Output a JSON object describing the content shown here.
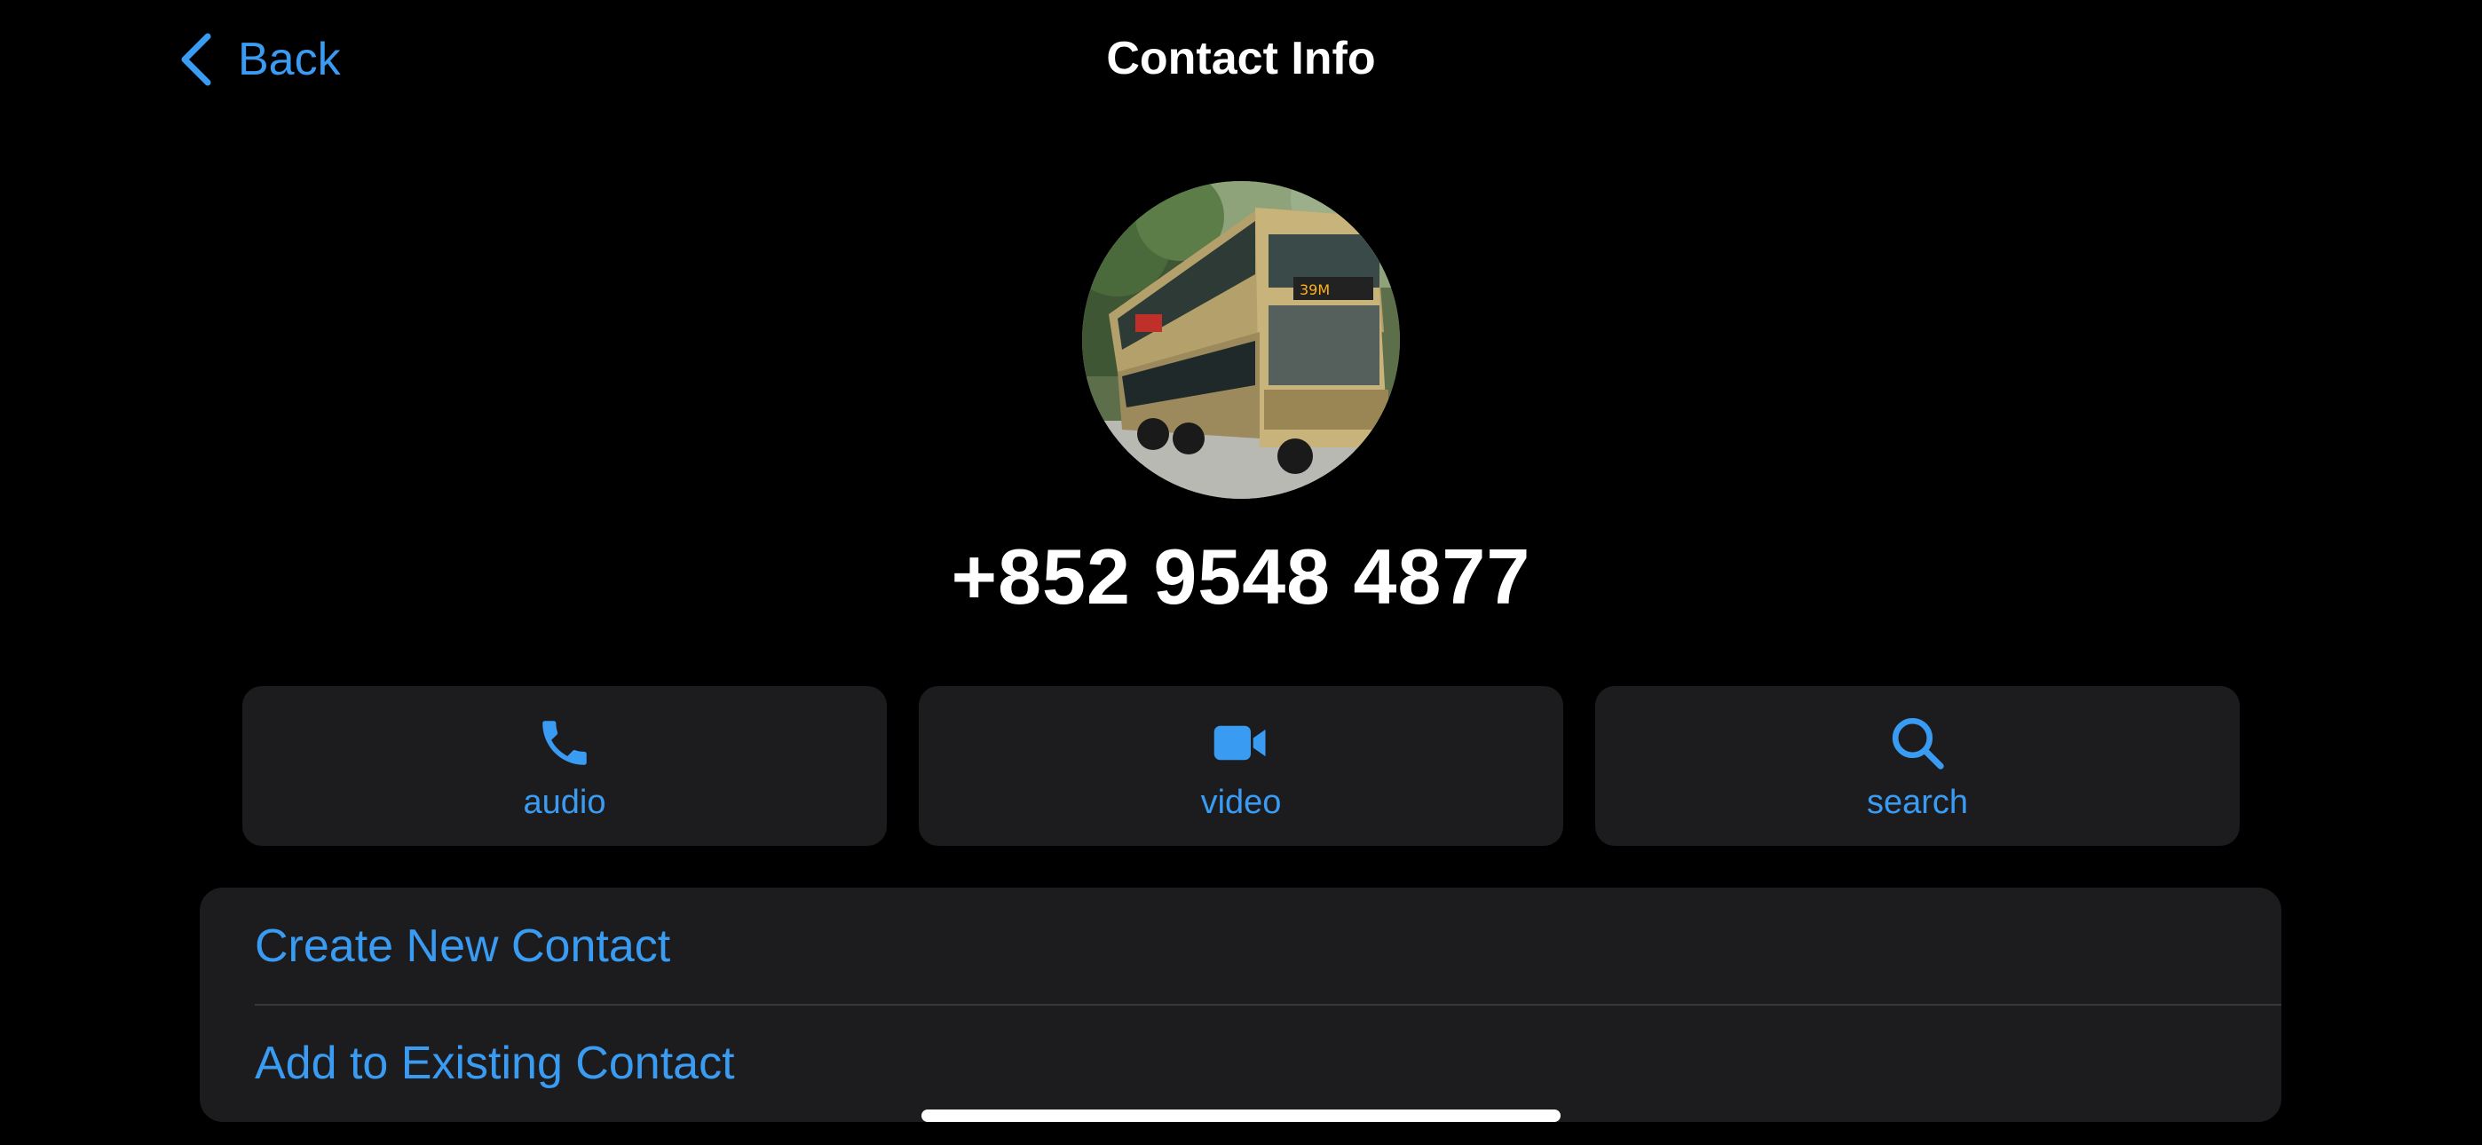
{
  "nav": {
    "back_label": "Back",
    "title": "Contact Info"
  },
  "contact": {
    "name": "+852 9548 4877",
    "avatar_icon": "bus-photo"
  },
  "actions": [
    {
      "label": "audio",
      "icon": "phone-icon"
    },
    {
      "label": "video",
      "icon": "video-camera-icon"
    },
    {
      "label": "search",
      "icon": "search-icon"
    }
  ],
  "list": {
    "create_new_contact": "Create New Contact",
    "add_to_existing_contact": "Add to Existing Contact"
  },
  "colors": {
    "background": "#000000",
    "accent": "#3a9bf3",
    "card": "#1c1c1e",
    "text": "#ffffff",
    "divider": "#38383a"
  }
}
